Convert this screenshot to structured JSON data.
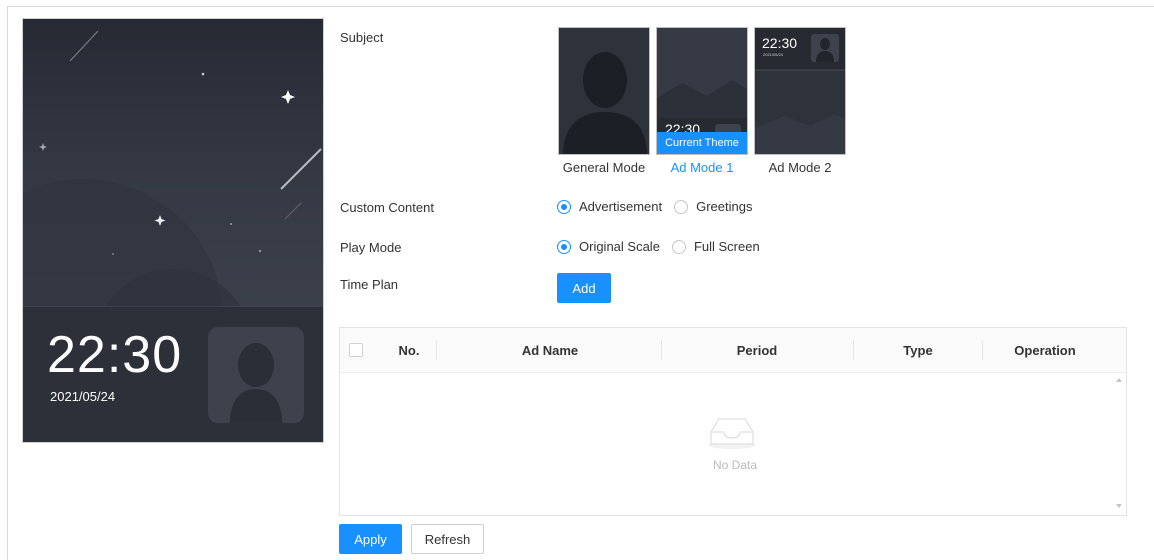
{
  "preview": {
    "time": "22:30",
    "date": "2021/05/24"
  },
  "form": {
    "subject_label": "Subject",
    "themes": [
      {
        "label": "General Mode",
        "active": false
      },
      {
        "label": "Ad Mode 1",
        "active": true,
        "badge": "Current Theme",
        "thumb_time": "22:30"
      },
      {
        "label": "Ad Mode 2",
        "active": false,
        "thumb_time": "22:30",
        "thumb_date": "2021/05/24"
      }
    ],
    "custom_content": {
      "label": "Custom Content",
      "options": [
        "Advertisement",
        "Greetings"
      ],
      "selected": "Advertisement"
    },
    "play_mode": {
      "label": "Play Mode",
      "options": [
        "Original Scale",
        "Full Screen"
      ],
      "selected": "Original Scale"
    },
    "time_plan": {
      "label": "Time Plan",
      "add_button": "Add"
    }
  },
  "table": {
    "columns": [
      "No.",
      "Ad Name",
      "Period",
      "Type",
      "Operation"
    ],
    "rows": [],
    "empty_text": "No Data"
  },
  "footer": {
    "apply": "Apply",
    "refresh": "Refresh"
  },
  "colors": {
    "accent": "#1890ff",
    "preview_bg": "#2c3039"
  }
}
